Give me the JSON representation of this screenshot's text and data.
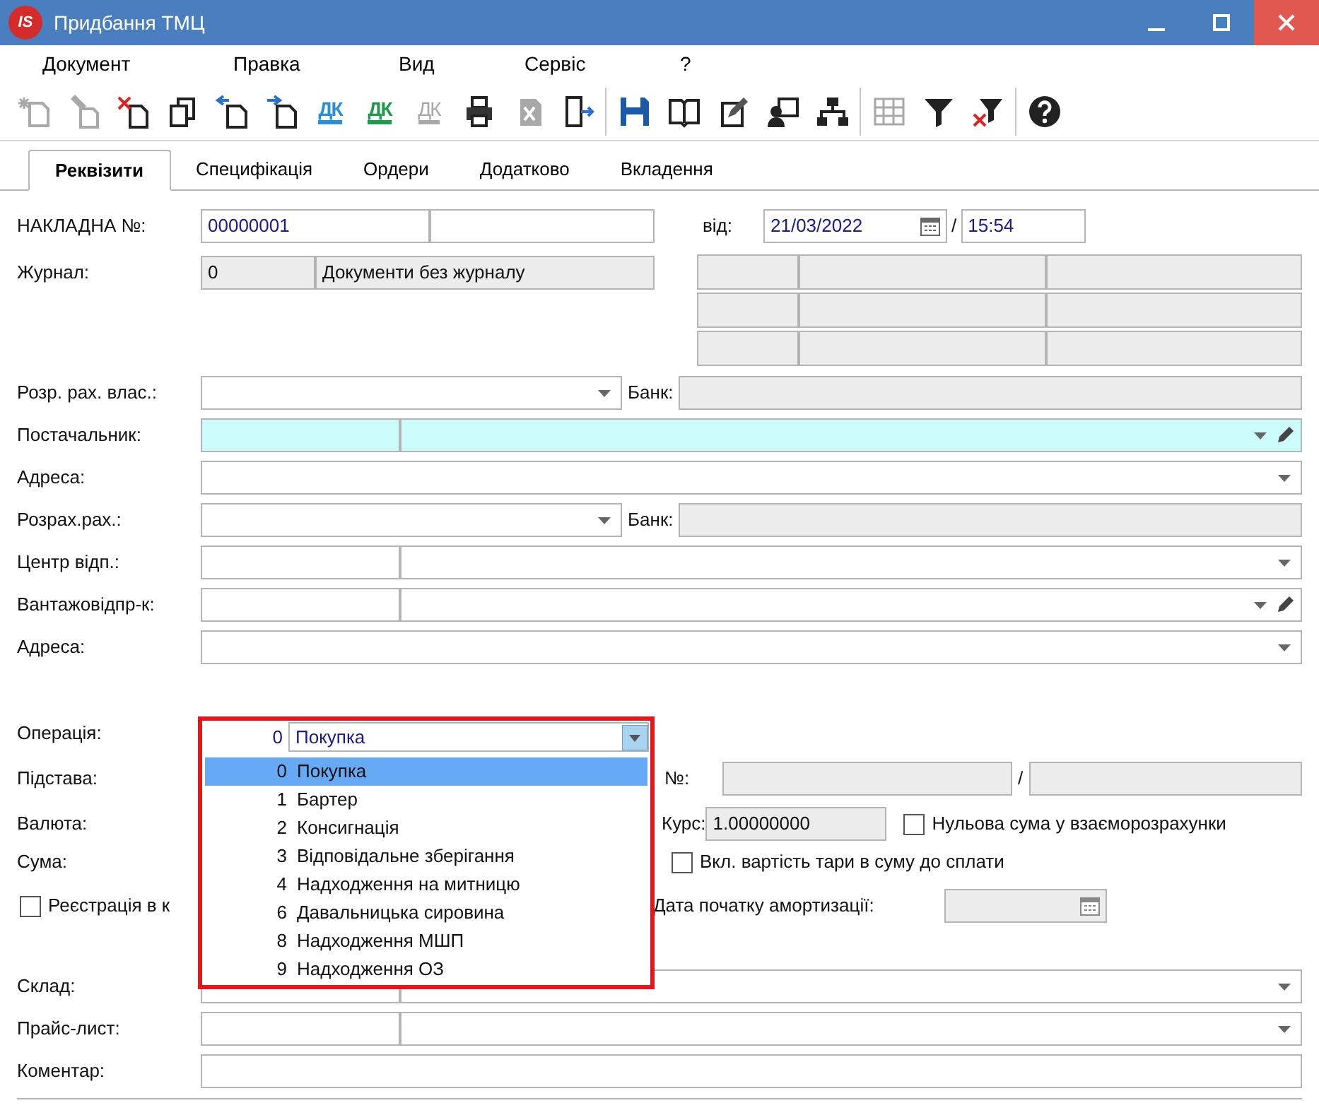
{
  "window": {
    "logo": "IS",
    "title": "Придбання ТМЦ"
  },
  "menu": [
    "Документ",
    "Правка",
    "Вид",
    "Сервіс",
    "?"
  ],
  "toolbar": [
    {
      "kind": "new",
      "disabled": true
    },
    {
      "kind": "edit",
      "disabled": true
    },
    {
      "kind": "delete",
      "disabled": false
    },
    {
      "kind": "copy",
      "disabled": false
    },
    {
      "kind": "back",
      "disabled": false
    },
    {
      "kind": "forward",
      "disabled": false
    },
    {
      "kind": "dk",
      "label": "ДК",
      "color": "#2a8fd6",
      "disabled": false
    },
    {
      "kind": "dk",
      "label": "ДК",
      "color": "#1e9a4a",
      "disabled": false
    },
    {
      "kind": "dk",
      "label": "ДК",
      "color": "#a8a8a8",
      "disabled": true
    },
    {
      "kind": "print",
      "disabled": false
    },
    {
      "kind": "excel",
      "disabled": true
    },
    {
      "kind": "exit",
      "disabled": false
    },
    {
      "kind": "separator"
    },
    {
      "kind": "save",
      "disabled": false
    },
    {
      "kind": "book",
      "disabled": false
    },
    {
      "kind": "edit-doc",
      "disabled": false
    },
    {
      "kind": "user",
      "disabled": false
    },
    {
      "kind": "tree",
      "disabled": false
    },
    {
      "kind": "separator"
    },
    {
      "kind": "grid",
      "disabled": true
    },
    {
      "kind": "filter",
      "disabled": false
    },
    {
      "kind": "filter-clear",
      "disabled": false
    },
    {
      "kind": "separator"
    },
    {
      "kind": "help",
      "disabled": false
    }
  ],
  "tabs": [
    {
      "label": "Реквізити",
      "selected": true
    },
    {
      "label": "Специфікація",
      "selected": false
    },
    {
      "label": "Ордери",
      "selected": false
    },
    {
      "label": "Додатково",
      "selected": false
    },
    {
      "label": "Вкладення",
      "selected": false
    }
  ],
  "header": {
    "invoice_label": "НАКЛАДНА №:",
    "invoice_number": "00000001",
    "date_label": "від:",
    "date": "21/03/2022",
    "time_separator": "/",
    "time": "15:54"
  },
  "journal": {
    "label": "Журнал:",
    "code": "0",
    "name": "Документи без журналу"
  },
  "rows": [
    {
      "label": "Розр. рах. влас.:",
      "kind": "account",
      "bank_label": "Банк:"
    },
    {
      "label": "Постачальник:",
      "kind": "split",
      "highlighted": true,
      "editable": true
    },
    {
      "label": "Адреса:",
      "kind": "combo"
    },
    {
      "label": "Розрах.рах.:",
      "kind": "account",
      "bank_label": "Банк:"
    },
    {
      "label": "Центр відп.:",
      "kind": "split",
      "highlighted": false,
      "editable": false
    },
    {
      "label": "Вантажовідпр-к:",
      "kind": "split",
      "highlighted": false,
      "editable": true
    },
    {
      "label": "Адреса:",
      "kind": "combo"
    }
  ],
  "operation": {
    "label": "Операція:",
    "code": "0",
    "name": "Покупка",
    "options": [
      {
        "code": "0",
        "name": "Покупка",
        "selected": true
      },
      {
        "code": "1",
        "name": "Бартер",
        "selected": false
      },
      {
        "code": "2",
        "name": "Консигнація",
        "selected": false
      },
      {
        "code": "3",
        "name": "Відповідальне зберігання",
        "selected": false
      },
      {
        "code": "4",
        "name": "Надходження на митницю",
        "selected": false
      },
      {
        "code": "6",
        "name": "Давальницька сировина",
        "selected": false
      },
      {
        "code": "8",
        "name": "Надходження МШП",
        "selected": false
      },
      {
        "code": "9",
        "name": "Надходження ОЗ",
        "selected": false
      }
    ]
  },
  "basis": {
    "label": "Підстава:",
    "number_label": "№:",
    "separator": "/"
  },
  "currency": {
    "label": "Валюта:",
    "rate_label": "Курс:",
    "rate": "1.00000000",
    "zero_sum": {
      "label": "Нульова сума у взаєморозрахунки",
      "checked": false
    }
  },
  "sum": {
    "label": "Сума:",
    "tare": {
      "label": "Вкл. вартість тари в суму до сплати",
      "checked": false
    }
  },
  "registration": {
    "label": "Реєстрація в к",
    "checked": false
  },
  "depreciation": {
    "label": "Дата початку амортизації:"
  },
  "bottom_rows": [
    {
      "label": "Склад:",
      "kind": "split",
      "highlighted": false,
      "editable": false
    },
    {
      "label": "Прайс-лист:",
      "kind": "split",
      "highlighted": false,
      "editable": false
    },
    {
      "label": "Коментар:",
      "kind": "text"
    }
  ]
}
